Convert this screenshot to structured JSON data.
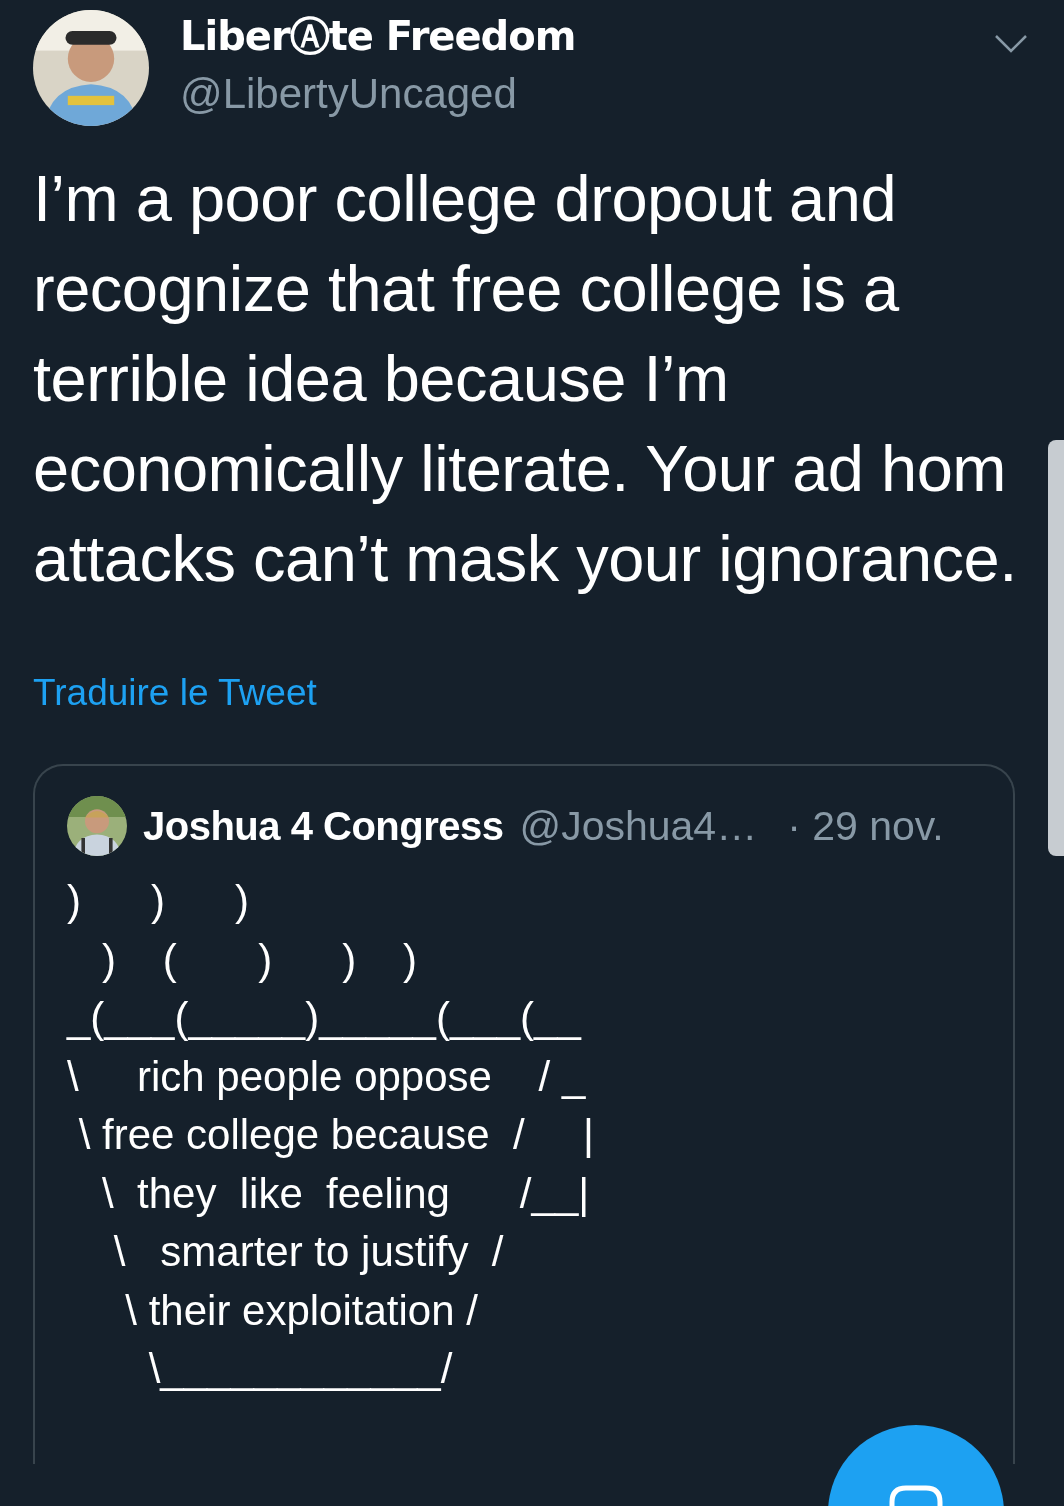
{
  "tweet": {
    "author": {
      "name": "LiberⒶte Freedom",
      "handle": "@LibertyUncaged"
    },
    "text": "I’m a poor college dropout and recognize that free college is a terrible idea because I’m economically literate. Your ad hom attacks can’t mask your ignorance.",
    "translate_link": "Traduire le Tweet",
    "quoted_tweet": {
      "author": {
        "name": "Joshua 4 Congress",
        "handle": "@Joshua4…"
      },
      "date": "· 29 nov.",
      "lines": [
        ")      )      )",
        "   )    (       )      )    )",
        "_(___(_____)_____(___(__",
        "\\     rich people oppose    / _",
        " \\ free college because  /     |",
        "   \\  they  like  feeling      /__|",
        "    \\   smarter to justify  /",
        "     \\ their exploitation /",
        "       \\____________/"
      ]
    }
  }
}
